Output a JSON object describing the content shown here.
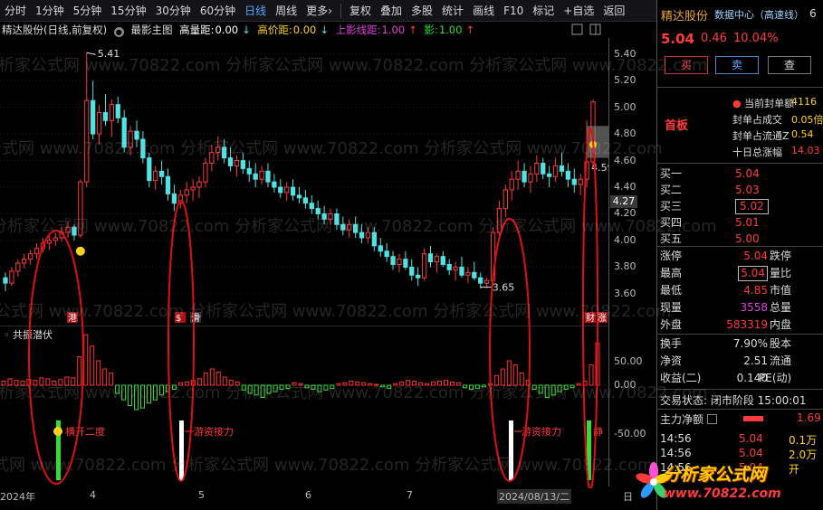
{
  "toolbar": {
    "periods": [
      "分时",
      "1分钟",
      "5分钟",
      "15分钟",
      "30分钟",
      "60分钟",
      "日线",
      "周线",
      "更多"
    ],
    "more_arrow": "›",
    "tools": [
      "复权",
      "叠加",
      "多股",
      "统计",
      "画线",
      "F10",
      "标记",
      "+自选",
      "返回"
    ]
  },
  "info": {
    "stock": "精达股份(日线,前复权)",
    "indicator": "最影主图",
    "f1_label": "高量距:",
    "f1_value": "0.00",
    "f2_label": "高价距:",
    "f2_value": "0.00",
    "f3_label": "上影线距:",
    "f3_value": "1.00",
    "f4_label": "影:",
    "f4_value": "1.00"
  },
  "chart_data": {
    "type": "candlestick",
    "x_labels": [
      "2024年",
      "4",
      "5",
      "6",
      "7",
      "2024/08/13/二"
    ],
    "ylim": [
      3.45,
      5.52
    ],
    "y_ticks": [
      "5.40",
      "5.20",
      "5.00",
      "4.80",
      "4.60",
      "4.40",
      "4.20",
      "4.00",
      "3.80",
      "3.60"
    ],
    "current_price_tag": "4.27",
    "annotations": {
      "high": "5.41",
      "low": "3.65",
      "last_marker": "4.59"
    },
    "candles": [
      [
        3.72,
        3.76,
        3.62,
        3.68
      ],
      [
        3.68,
        3.8,
        3.66,
        3.77
      ],
      [
        3.77,
        3.86,
        3.73,
        3.83
      ],
      [
        3.83,
        3.9,
        3.79,
        3.86
      ],
      [
        3.86,
        3.93,
        3.82,
        3.9
      ],
      [
        3.9,
        3.98,
        3.86,
        3.94
      ],
      [
        3.94,
        4.02,
        3.91,
        3.98
      ],
      [
        3.98,
        4.05,
        3.93,
        4.0
      ],
      [
        4.0,
        4.06,
        3.96,
        4.02
      ],
      [
        4.02,
        4.1,
        3.99,
        4.06
      ],
      [
        4.06,
        4.14,
        4.02,
        4.1
      ],
      [
        4.1,
        4.12,
        4.0,
        4.04
      ],
      [
        4.04,
        4.46,
        4.02,
        4.44
      ],
      [
        4.44,
        5.41,
        4.4,
        5.05
      ],
      [
        5.05,
        5.2,
        4.76,
        4.8
      ],
      [
        4.8,
        5.02,
        4.72,
        4.96
      ],
      [
        4.96,
        5.1,
        4.86,
        4.9
      ],
      [
        4.9,
        5.06,
        4.78,
        5.02
      ],
      [
        5.02,
        5.08,
        4.88,
        4.92
      ],
      [
        4.92,
        4.98,
        4.66,
        4.7
      ],
      [
        4.7,
        4.86,
        4.64,
        4.82
      ],
      [
        4.82,
        4.9,
        4.7,
        4.76
      ],
      [
        4.76,
        4.82,
        4.58,
        4.62
      ],
      [
        4.62,
        4.66,
        4.4,
        4.45
      ],
      [
        4.45,
        4.56,
        4.38,
        4.52
      ],
      [
        4.52,
        4.6,
        4.42,
        4.48
      ],
      [
        4.48,
        4.54,
        4.3,
        4.35
      ],
      [
        4.35,
        4.42,
        4.22,
        4.28
      ],
      [
        4.28,
        4.38,
        4.24,
        4.34
      ],
      [
        4.34,
        4.44,
        4.28,
        4.38
      ],
      [
        4.38,
        4.46,
        4.3,
        4.4
      ],
      [
        4.4,
        4.48,
        4.32,
        4.44
      ],
      [
        4.44,
        4.62,
        4.4,
        4.58
      ],
      [
        4.58,
        4.72,
        4.52,
        4.66
      ],
      [
        4.66,
        4.78,
        4.6,
        4.7
      ],
      [
        4.7,
        4.76,
        4.58,
        4.62
      ],
      [
        4.62,
        4.7,
        4.52,
        4.56
      ],
      [
        4.56,
        4.64,
        4.48,
        4.6
      ],
      [
        4.6,
        4.66,
        4.5,
        4.54
      ],
      [
        4.54,
        4.6,
        4.44,
        4.5
      ],
      [
        4.5,
        4.58,
        4.4,
        4.46
      ],
      [
        4.46,
        4.56,
        4.42,
        4.52
      ],
      [
        4.52,
        4.58,
        4.4,
        4.44
      ],
      [
        4.44,
        4.5,
        4.36,
        4.4
      ],
      [
        4.4,
        4.46,
        4.32,
        4.36
      ],
      [
        4.36,
        4.44,
        4.3,
        4.4
      ],
      [
        4.4,
        4.46,
        4.3,
        4.34
      ],
      [
        4.34,
        4.4,
        4.28,
        4.32
      ],
      [
        4.32,
        4.38,
        4.24,
        4.28
      ],
      [
        4.28,
        4.34,
        4.2,
        4.24
      ],
      [
        4.24,
        4.3,
        4.16,
        4.2
      ],
      [
        4.2,
        4.26,
        4.12,
        4.16
      ],
      [
        4.16,
        4.24,
        4.12,
        4.2
      ],
      [
        4.2,
        4.24,
        4.08,
        4.12
      ],
      [
        4.12,
        4.18,
        4.04,
        4.08
      ],
      [
        4.08,
        4.16,
        4.02,
        4.12
      ],
      [
        4.12,
        4.18,
        4.02,
        4.06
      ],
      [
        4.06,
        4.12,
        3.98,
        4.02
      ],
      [
        4.02,
        4.1,
        3.98,
        4.06
      ],
      [
        4.06,
        4.1,
        3.92,
        3.96
      ],
      [
        3.96,
        4.02,
        3.88,
        3.92
      ],
      [
        3.92,
        3.98,
        3.84,
        3.88
      ],
      [
        3.88,
        3.92,
        3.78,
        3.82
      ],
      [
        3.82,
        3.9,
        3.76,
        3.86
      ],
      [
        3.86,
        3.92,
        3.78,
        3.8
      ],
      [
        3.8,
        3.86,
        3.7,
        3.74
      ],
      [
        3.74,
        3.8,
        3.66,
        3.72
      ],
      [
        3.72,
        3.94,
        3.7,
        3.9
      ],
      [
        3.9,
        3.96,
        3.8,
        3.84
      ],
      [
        3.84,
        3.9,
        3.76,
        3.88
      ],
      [
        3.88,
        3.92,
        3.8,
        3.82
      ],
      [
        3.82,
        3.86,
        3.74,
        3.78
      ],
      [
        3.78,
        3.84,
        3.7,
        3.8
      ],
      [
        3.8,
        3.88,
        3.72,
        3.74
      ],
      [
        3.74,
        3.8,
        3.68,
        3.76
      ],
      [
        3.76,
        3.84,
        3.7,
        3.72
      ],
      [
        3.72,
        3.76,
        3.64,
        3.68
      ],
      [
        3.68,
        3.72,
        3.64,
        3.7
      ],
      [
        3.7,
        4.1,
        3.66,
        4.06
      ],
      [
        4.06,
        4.3,
        4.0,
        4.24
      ],
      [
        4.24,
        4.42,
        4.18,
        4.38
      ],
      [
        4.38,
        4.52,
        4.3,
        4.46
      ],
      [
        4.46,
        4.6,
        4.38,
        4.52
      ],
      [
        4.52,
        4.58,
        4.4,
        4.44
      ],
      [
        4.44,
        4.56,
        4.36,
        4.5
      ],
      [
        4.5,
        4.64,
        4.44,
        4.58
      ],
      [
        4.58,
        4.62,
        4.46,
        4.5
      ],
      [
        4.5,
        4.56,
        4.4,
        4.48
      ],
      [
        4.48,
        4.62,
        4.44,
        4.56
      ],
      [
        4.56,
        4.66,
        4.48,
        4.52
      ],
      [
        4.52,
        4.58,
        4.4,
        4.46
      ],
      [
        4.46,
        4.54,
        4.36,
        4.42
      ],
      [
        4.42,
        4.5,
        4.34,
        4.46
      ],
      [
        4.46,
        4.9,
        4.4,
        4.59
      ],
      [
        4.59,
        5.06,
        4.55,
        5.04
      ]
    ],
    "volume_bars": [
      0.05,
      0.08,
      0.06,
      0.05,
      0.07,
      0.06,
      0.09,
      0.08,
      0.05,
      0.07,
      0.1,
      0.09,
      0.35,
      0.62,
      0.48,
      0.3,
      0.2,
      0.15,
      -0.1,
      -0.18,
      -0.25,
      -0.3,
      -0.28,
      -0.22,
      -0.18,
      -0.12,
      -0.08,
      -0.05,
      0.03,
      0.04,
      0.06,
      0.08,
      0.15,
      0.2,
      0.16,
      0.1,
      0.06,
      0.04,
      -0.06,
      -0.1,
      -0.12,
      -0.15,
      -0.1,
      -0.08,
      -0.05,
      -0.04,
      0.03,
      0.02,
      -0.03,
      -0.05,
      -0.08,
      -0.06,
      -0.04,
      0.02,
      0.03,
      0.05,
      0.04,
      0.03,
      0.02,
      0.01,
      -0.02,
      -0.04,
      0.02,
      0.04,
      0.06,
      0.05,
      0.03,
      0.02,
      0.04,
      0.05,
      0.06,
      0.04,
      0.03,
      -0.03,
      -0.05,
      -0.04,
      -0.02,
      0.02,
      0.12,
      0.2,
      0.3,
      0.25,
      0.15,
      0.06,
      -0.05,
      -0.1,
      -0.15,
      -0.12,
      -0.08,
      -0.05,
      -0.03,
      0.02,
      0.05,
      0.25,
      0.52
    ],
    "sub_ticks": [
      "50.00",
      "0.00",
      "-50.00"
    ]
  },
  "chart_labels": {
    "tag1": "港",
    "tag2": "$",
    "tag3": "滑",
    "tag4": "财",
    "tag5": "涨",
    "sub_title": "共振潜伏",
    "signal1": "横开二度",
    "signal2": "游资接力",
    "signal3": "游资接力",
    "signal4": "静"
  },
  "panel": {
    "name": "精达股份",
    "link": "数据中心（高速线）",
    "unit_glyph": "6",
    "price": "5.04",
    "change": "0.46",
    "pct": "10.04%",
    "buy": "买",
    "sell": "卖",
    "query": "查",
    "seal_rows": [
      {
        "k": "当前封单额",
        "v": "4116"
      },
      {
        "k": "封单占成交",
        "v": "0.05倍"
      },
      {
        "k": "封单占流通Z",
        "v": "0.54"
      },
      {
        "k": "十日总涨幅",
        "v": "14.03"
      }
    ],
    "shouban": "首板",
    "orders": [
      {
        "l": "买一",
        "p": "5.04",
        "q": ""
      },
      {
        "l": "买二",
        "p": "5.03",
        "q": ""
      },
      {
        "l": "买三",
        "p": "5.02",
        "q": ""
      },
      {
        "l": "买四",
        "p": "5.01",
        "q": ""
      },
      {
        "l": "买五",
        "p": "5.00",
        "q": ""
      }
    ],
    "quote": [
      {
        "k1": "涨停",
        "v1": "5.04",
        "k2": "跌停"
      },
      {
        "k1": "最高",
        "v1": "5.04",
        "k2": "量比"
      },
      {
        "k1": "最低",
        "v1": "4.85",
        "k2": "市值"
      },
      {
        "k1": "现量",
        "v1": "3558",
        "k2": "总量"
      },
      {
        "k1": "外盘",
        "v1": "583319",
        "k2": "内盘"
      }
    ],
    "stats": [
      {
        "k1": "换手",
        "v1": "7.90%",
        "k2": "股本"
      },
      {
        "k1": "净资",
        "v1": "2.51",
        "k2": "流通"
      },
      {
        "k1": "收益(二)",
        "v1": "0.140",
        "k2": "PE(动)"
      }
    ],
    "state": "交易状态: 闭市阶段 15:00:01",
    "flow_label": "主力净额",
    "flow_value": "1.69",
    "ticks": [
      {
        "t": "14:56",
        "p": "5.04",
        "v": "0.1万"
      },
      {
        "t": "14:56",
        "p": "5.04",
        "v": "2.0万"
      },
      {
        "t": "14:56",
        "p": "5.04",
        "v": "开"
      }
    ]
  },
  "watermark": {
    "site": "分析家公式网 www.70822.com",
    "logo_cn": "分析家公式网",
    "logo_url": "www.70822.com"
  },
  "colors": {
    "up": "#ff3b3b",
    "down": "#4fe3e3",
    "sub_up": "#ff3030",
    "sub_down": "#33dd33",
    "accent_blue": "#5aa8ff",
    "ellipse": "#e01010",
    "yellow_dot": "#ffd21a"
  }
}
